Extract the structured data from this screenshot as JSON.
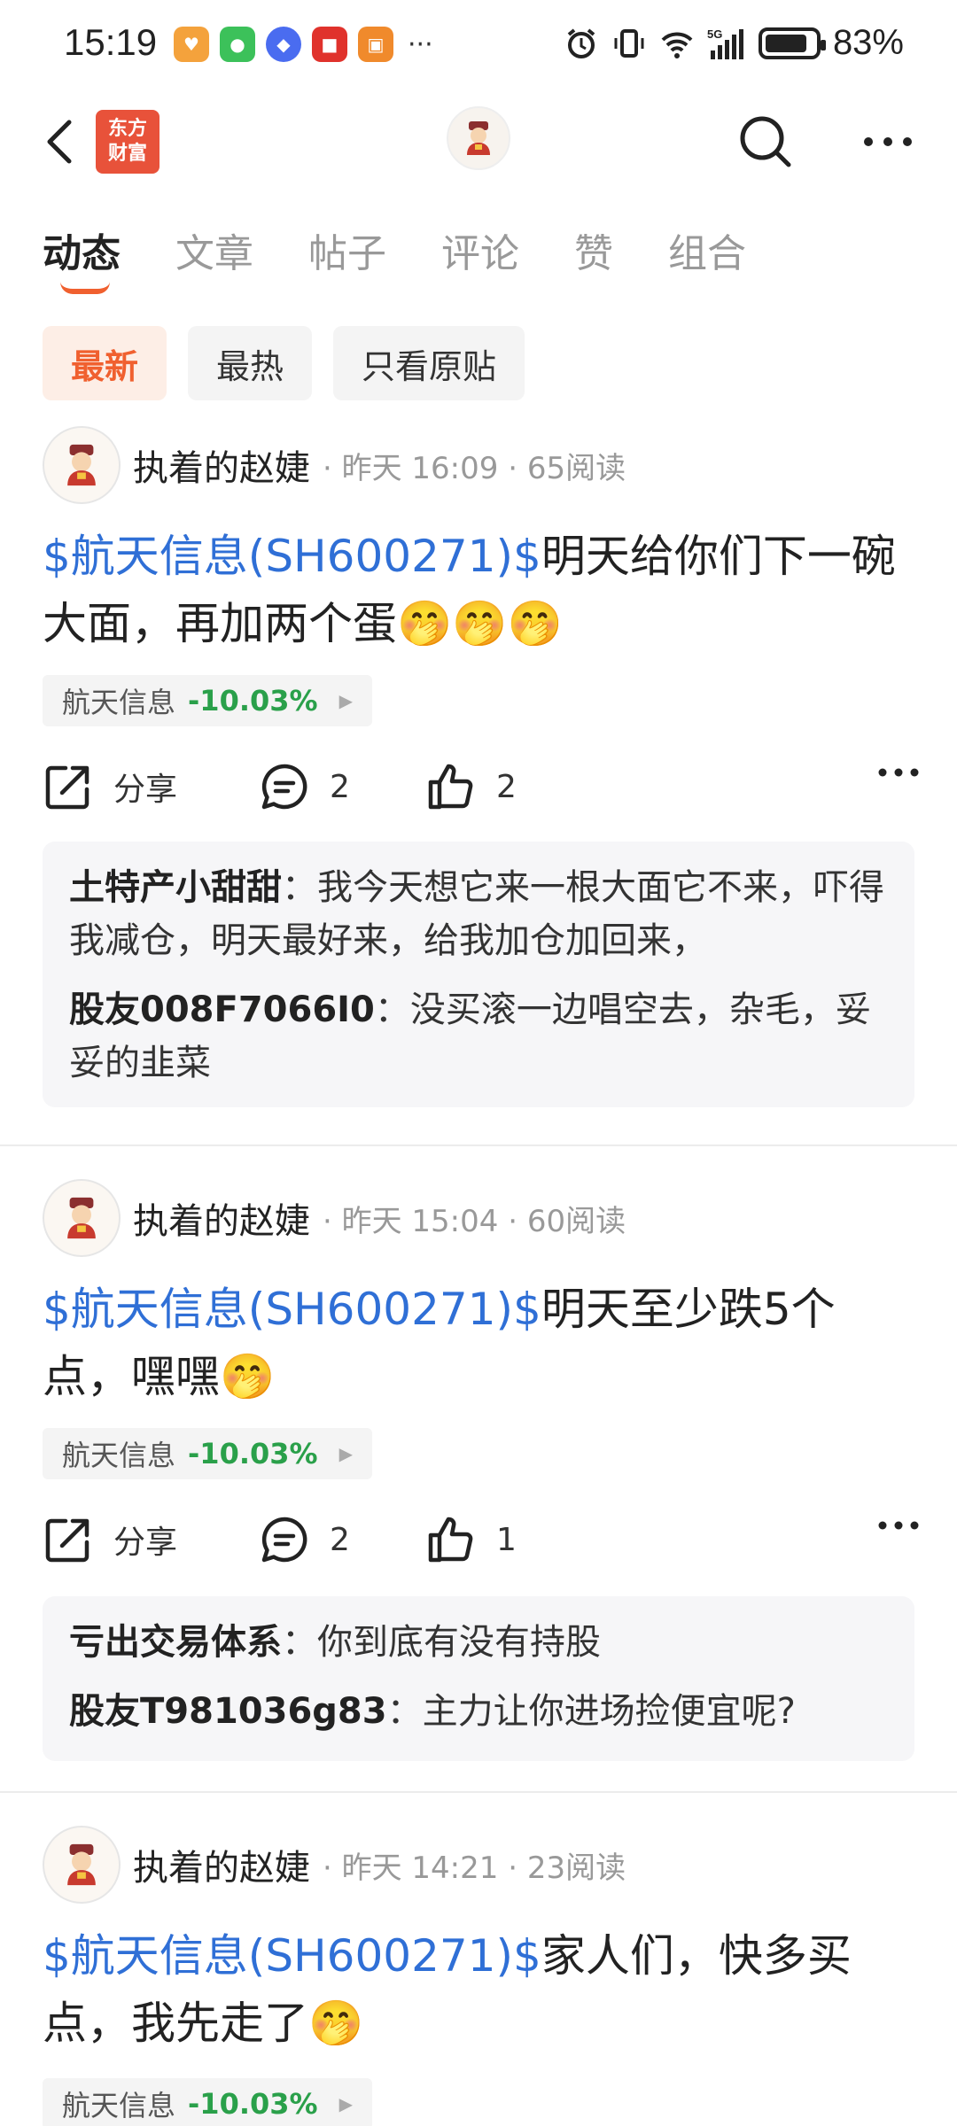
{
  "status_bar": {
    "time": "15:19",
    "battery_pct": "83%",
    "network": "5G",
    "app_icons": [
      "pet-icon",
      "wechat-icon",
      "planet-icon",
      "tmall-icon",
      "wallet-icon"
    ],
    "overflow": "···"
  },
  "header": {
    "logo_line1": "东方",
    "logo_line2": "财富",
    "logo_color": "#e8523a"
  },
  "tabs": [
    {
      "label": "动态"
    },
    {
      "label": "文章"
    },
    {
      "label": "帖子"
    },
    {
      "label": "评论"
    },
    {
      "label": "赞"
    },
    {
      "label": "组合"
    }
  ],
  "filters": [
    {
      "label": "最新"
    },
    {
      "label": "最热"
    },
    {
      "label": "只看原贴"
    }
  ],
  "accent_color": "#f0602f",
  "link_color": "#2f6fd6",
  "down_color": "#2aa04a",
  "posts": [
    {
      "author": "执着的赵婕",
      "meta": "· 昨天 16:09 · 65阅读",
      "ticker": "$航天信息(SH600271)$",
      "text": "明天给你们下一碗大面，再加两个蛋🤭🤭🤭",
      "stock_name": "航天信息",
      "stock_change": "-10.03%",
      "share_label": "分享",
      "comment_count": "2",
      "like_count": "2",
      "comments": [
        {
          "user": "土特产小甜甜",
          "text": "我今天想它来一根大面它不来，吓得我减仓，明天最好来，给我加仓加回来，"
        },
        {
          "user": "股友008F7066I0",
          "text": "没买滚一边唱空去，杂毛，妥妥的韭菜"
        }
      ]
    },
    {
      "author": "执着的赵婕",
      "meta": "· 昨天 15:04 · 60阅读",
      "ticker": "$航天信息(SH600271)$",
      "text": "明天至少跌5个点，嘿嘿🤭",
      "stock_name": "航天信息",
      "stock_change": "-10.03%",
      "share_label": "分享",
      "comment_count": "2",
      "like_count": "1",
      "comments": [
        {
          "user": "亏出交易体系",
          "text": "你到底有没有持股"
        },
        {
          "user": "股友T981036g83",
          "text": "主力让你进场捡便宜呢?"
        }
      ]
    },
    {
      "author": "执着的赵婕",
      "meta": "· 昨天 14:21 · 23阅读",
      "ticker": "$航天信息(SH600271)$",
      "text": "家人们，快多买点，我先走了🤭",
      "stock_name": "航天信息",
      "stock_change": "-10.03%"
    }
  ]
}
